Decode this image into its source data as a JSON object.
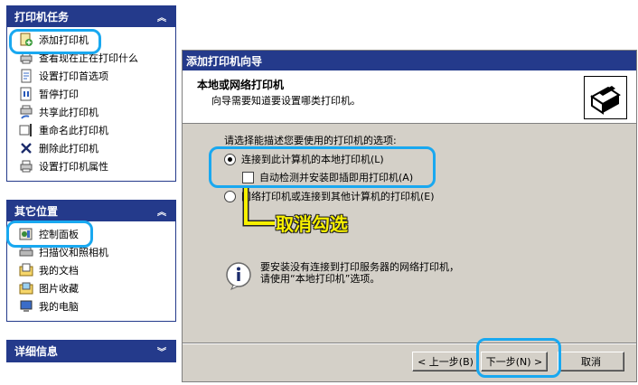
{
  "task_pane": {
    "title": "打印机任务",
    "items": [
      {
        "label": "添加打印机",
        "icon": "add-printer-icon"
      },
      {
        "label": "查看现在正在打印什么",
        "icon": "printer-queue-icon"
      },
      {
        "label": "设置打印首选项",
        "icon": "printer-preferences-icon"
      },
      {
        "label": "暂停打印",
        "icon": "pause-printing-icon"
      },
      {
        "label": "共享此打印机",
        "icon": "share-printer-icon"
      },
      {
        "label": "重命名此打印机",
        "icon": "rename-printer-icon"
      },
      {
        "label": "删除此打印机",
        "icon": "delete-x-icon"
      },
      {
        "label": "设置打印机属性",
        "icon": "printer-properties-icon"
      }
    ]
  },
  "other_places": {
    "title": "其它位置",
    "items": [
      {
        "label": "控制面板",
        "icon": "control-panel-icon"
      },
      {
        "label": "扫描仪和照相机",
        "icon": "scanner-camera-icon"
      },
      {
        "label": "我的文档",
        "icon": "my-documents-icon"
      },
      {
        "label": "图片收藏",
        "icon": "my-pictures-icon"
      },
      {
        "label": "我的电脑",
        "icon": "my-computer-icon"
      }
    ]
  },
  "details": {
    "title": "详细信息"
  },
  "wizard": {
    "title": "添加打印机向导",
    "heading": "本地或网络打印机",
    "subheading": "向导需要知道要设置哪类打印机。",
    "prompt": "请选择能描述您要使用的打印机的选项:",
    "option_local": "连接到此计算机的本地打印机(L)",
    "option_autodetect": "自动检测并安装即插即用打印机(A)",
    "option_network": "网络打印机或连接到其他计算机的打印机(E)",
    "info_line1": "要安装没有连接到打印服务器的网络打印机，",
    "info_line2": "请使用“本地打印机”选项。",
    "back_label": "< 上一步(B)",
    "next_label": "下一步(N) >",
    "cancel_label": "取消"
  },
  "annotation": {
    "text": "取消勾选"
  },
  "colors": {
    "header_blue": "#243a8b",
    "highlight": "#19a8f0",
    "annotation_yellow": "#f7f000"
  }
}
